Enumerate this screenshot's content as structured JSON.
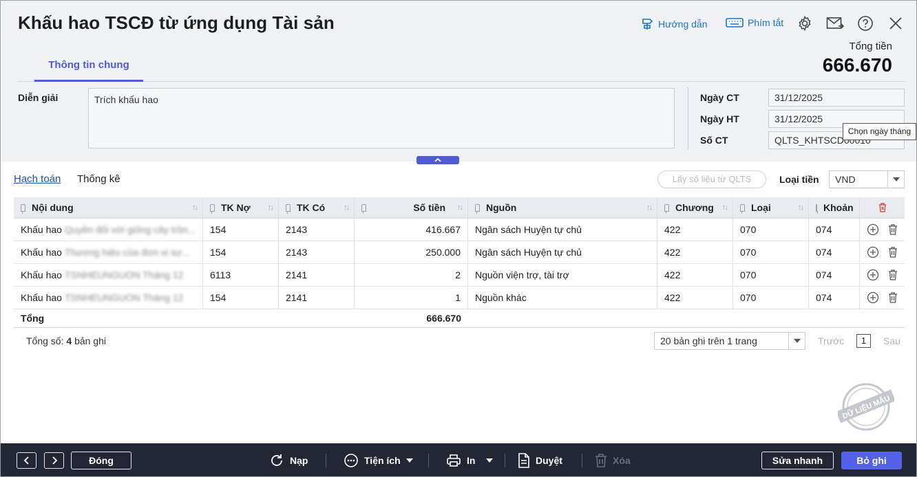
{
  "header": {
    "title": "Khấu hao TSCĐ từ ứng dụng Tài sản",
    "guide_label": "Hướng dẫn",
    "shortcut_label": "Phím tắt",
    "total_label": "Tổng tiền",
    "total_value": "666.670"
  },
  "tabs": [
    {
      "label": "Thông tin chung"
    }
  ],
  "form": {
    "description_label": "Diễn giải",
    "description_value": "Trích khấu hao",
    "voucher_date_label": "Ngày CT",
    "voucher_date_value": "31/12/2025",
    "posting_date_label": "Ngày HT",
    "posting_date_value": "31/12/2025",
    "voucher_no_label": "Số CT",
    "voucher_no_value": "QLTS_KHTSCD00010",
    "tooltip": "Chọn ngày tháng"
  },
  "grid_toolbar": {
    "tab_accounting": "Hạch toán",
    "tab_stats": "Thống kê",
    "fetch_button": "Lấy số liệu từ QLTS",
    "currency_label": "Loại tiền",
    "currency_value": "VND"
  },
  "grid": {
    "columns": [
      "Nội dung",
      "TK Nợ",
      "TK Có",
      "Số tiền",
      "Nguồn",
      "Chương",
      "Loại",
      "Khoản"
    ],
    "rows": [
      {
        "content": "Khấu hao",
        "content_blur": "Quyền đối với giống cây trồn...",
        "debit": "154",
        "credit": "2143",
        "amount": "416.667",
        "source": "Ngân sách Huyện tự chủ",
        "chapter": "422",
        "type": "070",
        "item": "074"
      },
      {
        "content": "Khấu hao",
        "content_blur": "Thương hiệu của đơn vị sự...",
        "debit": "154",
        "credit": "2143",
        "amount": "250.000",
        "source": "Ngân sách Huyện tự chủ",
        "chapter": "422",
        "type": "070",
        "item": "074"
      },
      {
        "content": "Khấu hao",
        "content_blur": "TSNHEUNGUON Tháng 12",
        "debit": "6113",
        "credit": "2141",
        "amount": "2",
        "source": "Nguồn viện trợ, tài trợ",
        "chapter": "422",
        "type": "070",
        "item": "074"
      },
      {
        "content": "Khấu hao",
        "content_blur": "TSNHEUNGUON Tháng 12",
        "debit": "154",
        "credit": "2141",
        "amount": "1",
        "source": "Nguồn khác",
        "chapter": "422",
        "type": "070",
        "item": "074"
      }
    ],
    "total_label": "Tổng",
    "total_value": "666.670"
  },
  "pager": {
    "count_prefix": "Tổng số:",
    "count_value": "4",
    "count_suffix": "bản ghi",
    "page_size": "20 bản ghi trên 1 trang",
    "prev": "Trước",
    "page": "1",
    "next": "Sau"
  },
  "stamp_text": "DỮ LIỆU MẪU",
  "footer": {
    "close": "Đóng",
    "reload": "Nạp",
    "utilities": "Tiện ích",
    "print": "In",
    "approve": "Duyệt",
    "delete": "Xóa",
    "quick_edit": "Sửa nhanh",
    "unpost": "Bỏ ghi"
  }
}
